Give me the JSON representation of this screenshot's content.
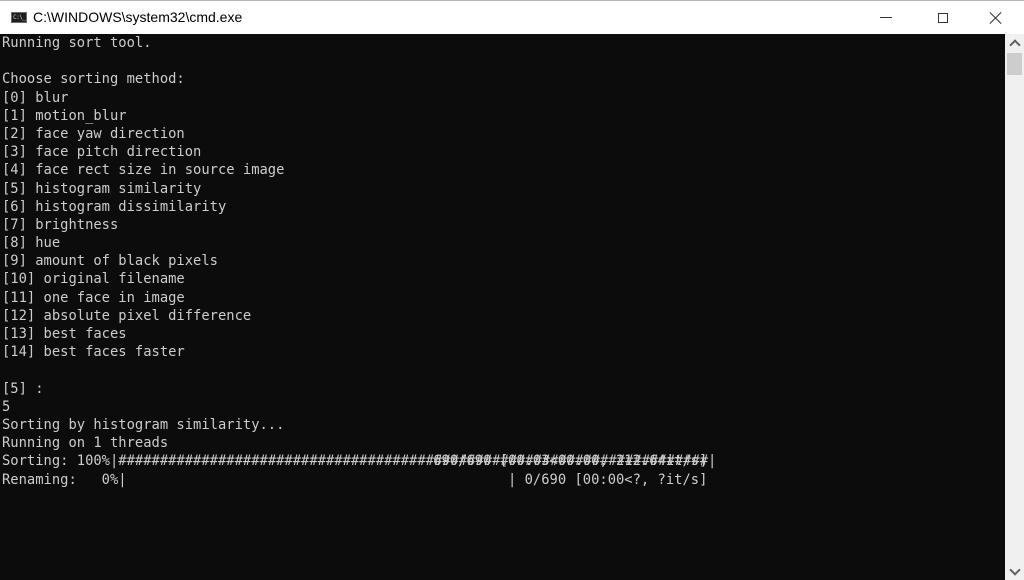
{
  "window": {
    "title": "C:\\WINDOWS\\system32\\cmd.exe",
    "icon": "cmd-icon",
    "icon_text": "C:\\_",
    "controls": {
      "minimize": "minimize-icon",
      "maximize": "maximize-icon",
      "close": "close-icon"
    }
  },
  "console": {
    "lines": [
      "Running sort tool.",
      "",
      "Choose sorting method:",
      "[0] blur",
      "[1] motion_blur",
      "[2] face yaw direction",
      "[3] face pitch direction",
      "[4] face rect size in source image",
      "[5] histogram similarity",
      "[6] histogram dissimilarity",
      "[7] brightness",
      "[8] hue",
      "[9] amount of black pixels",
      "[10] original filename",
      "[11] one face in image",
      "[12] absolute pixel difference",
      "[13] best faces",
      "[14] best faces faster",
      "",
      "[5] :",
      "5",
      "Sorting by histogram similarity...",
      "Running on 1 threads"
    ],
    "progress": [
      {
        "label": "Sorting: 100%|",
        "bar": "#######################################################################|",
        "percent": 100,
        "status": "690/690 [00:03<00:00, 212.64it/s]"
      },
      {
        "label": "Renaming:   0%|",
        "bar": "",
        "percent": 0,
        "status": "| 0/690 [00:00<?, ?it/s]"
      }
    ]
  },
  "colors": {
    "console_bg": "#0c0c0c",
    "console_fg": "#cccccc",
    "titlebar_bg": "#ffffff",
    "scrollbar_bg": "#f0f0f0",
    "scrollbar_thumb": "#cdcdcd"
  }
}
